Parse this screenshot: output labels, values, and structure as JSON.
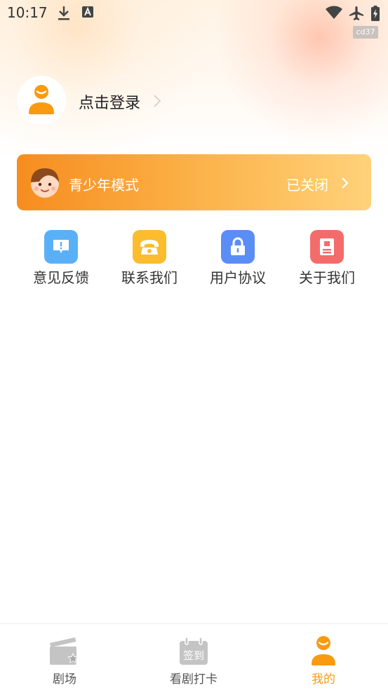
{
  "status_bar": {
    "time": "10:17",
    "build_tag": "cd37",
    "icons": [
      "download-icon",
      "font-a-icon",
      "wifi-icon",
      "airplane-icon",
      "battery-charging-icon"
    ]
  },
  "profile": {
    "login_label": "点击登录",
    "avatar_icon": "user-avatar-icon"
  },
  "youth_mode": {
    "label": "青少年模式",
    "status": "已关闭",
    "icon": "child-face-icon"
  },
  "shortcuts": [
    {
      "label": "意见反馈",
      "icon": "feedback-icon",
      "color": "#5ab0f7"
    },
    {
      "label": "联系我们",
      "icon": "telephone-icon",
      "color": "#fbbd2d"
    },
    {
      "label": "用户协议",
      "icon": "lock-icon",
      "color": "#5b8df6"
    },
    {
      "label": "关于我们",
      "icon": "document-icon",
      "color": "#f46b6b"
    }
  ],
  "bottom_nav": {
    "items": [
      {
        "label": "剧场",
        "icon": "clapperboard-icon"
      },
      {
        "label": "看剧打卡",
        "icon": "calendar-checkin-icon",
        "badge": "签到"
      },
      {
        "label": "我的",
        "icon": "profile-icon"
      }
    ],
    "active_label": "我的",
    "active_color": "#f99a11"
  },
  "colors": {
    "accent": "#f99a11",
    "banner_start": "#f78c1f",
    "banner_end": "#ffd27a"
  }
}
